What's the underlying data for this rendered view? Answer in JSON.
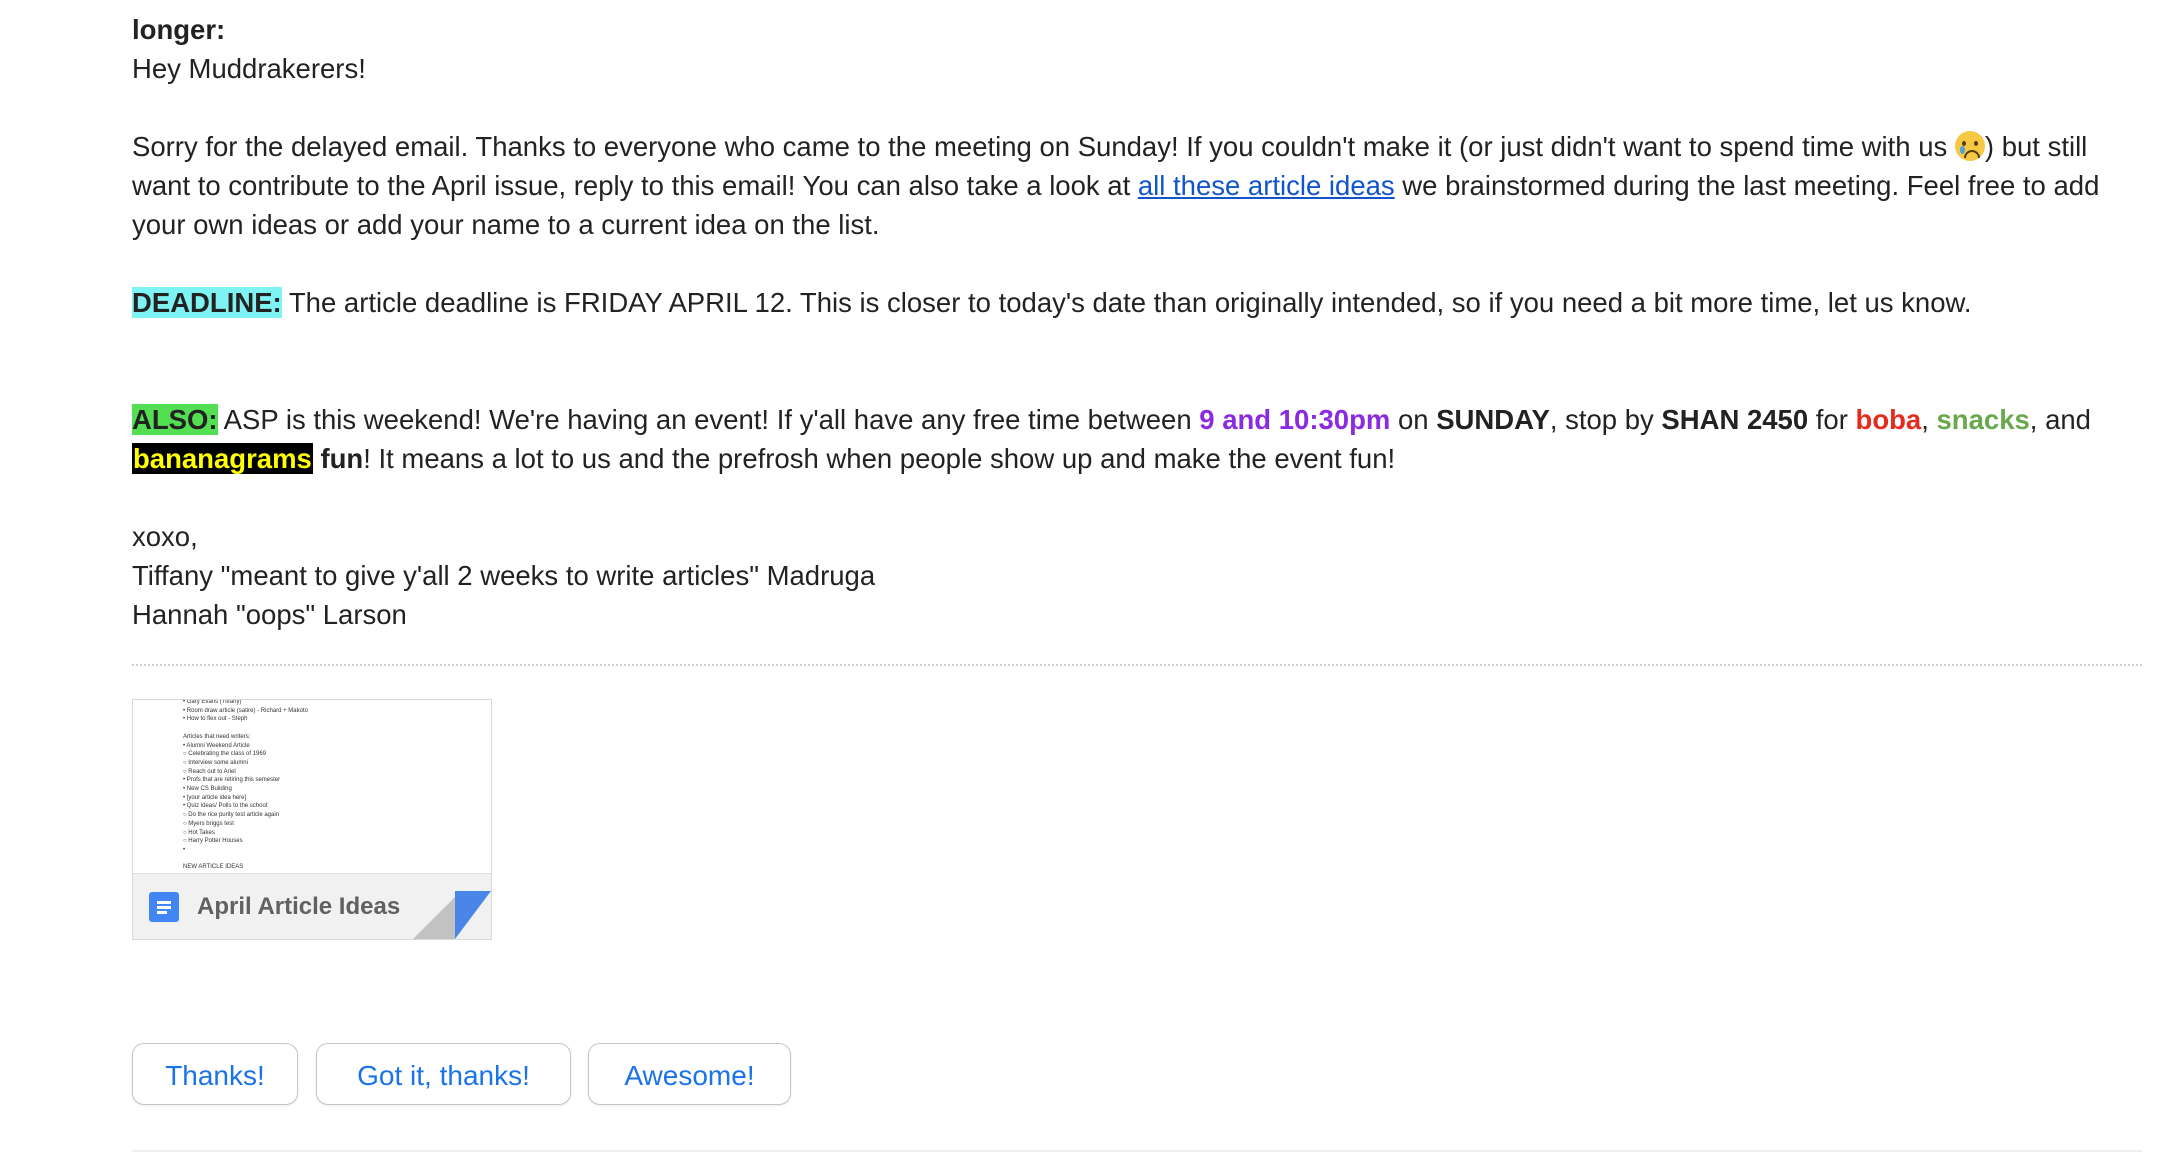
{
  "email": {
    "lead_heading": "longer:",
    "greeting": "Hey Muddrakerers!",
    "para1": {
      "text_a": "Sorry for the delayed email. Thanks to everyone who came to the meeting on Sunday! If you couldn't make it (or just didn't want to spend time with us ",
      "emoji_name": "crying-face-icon",
      "text_b": ") but still want to contribute to the April issue, reply to this email! You can also take a look at ",
      "link_text": "all these article ideas",
      "text_c": " we brainstormed during the last meeting. Feel free to add your own ideas or add your name to a current idea on the list."
    },
    "deadline": {
      "label": "DEADLINE:",
      "text": " The article deadline is FRIDAY APRIL 12. This is closer to today's date than originally intended, so if you need a bit more time, let us know."
    },
    "also": {
      "label": "ALSO:",
      "t1": " ASP is this weekend! We're having an event! If y'all have any free time between ",
      "time": "9 and 10:30pm",
      "t2": " on ",
      "day": "SUNDAY",
      "t3": ", stop by ",
      "place": "SHAN 2450",
      "t4": " for ",
      "item1": "boba",
      "t5": ", ",
      "item2": "snacks",
      "t6": ", and",
      "item3": "bananagrams",
      "t7": " ",
      "fun": "fun",
      "t8": "! It means a lot to us and the prefrosh when people show up and make the event fun!"
    },
    "signoff": "xoxo,",
    "sig1": "Tiffany \"meant to give y'all 2 weeks to write articles\" Madruga",
    "sig2": "Hannah \"oops\" Larson"
  },
  "attachment": {
    "title": "April Article Ideas",
    "icon": "google-docs-icon",
    "preview_lines": [
      "•  Gary Evans (Tiffany)",
      "•  Room draw article (satire) - Richard + Makoto",
      "•  How to flex out - Steph",
      "",
      "Articles that need writers:",
      "•  Alumni Weekend Article",
      "      ○  Celebrating the class of 1969",
      "      ○  Interview some alumni",
      "      ○  Reach out to Ariel",
      "•  Profs that are retiring this semester",
      "•  New CS Building",
      "•  [your article idea here]",
      "•  Quiz ideas/ Polls to the school:",
      "      ○  Do the rice purity test article again",
      "      ○  Myers briggs test",
      "      ○  Hot Takes",
      "      ○  Harry Potter Houses",
      "•",
      "",
      "NEW ARTICLE IDEAS"
    ]
  },
  "smart_replies": [
    "Thanks!",
    "Got it, thanks!",
    "Awesome!"
  ],
  "colors": {
    "link": "#1155cc",
    "deadline_highlight": "#7ff3f3",
    "also_highlight": "#52e052",
    "time_purple": "#8a2be2",
    "boba_red": "#e52b1e",
    "snacks_green": "#6aa84f",
    "chip_text": "#1a73e8"
  }
}
